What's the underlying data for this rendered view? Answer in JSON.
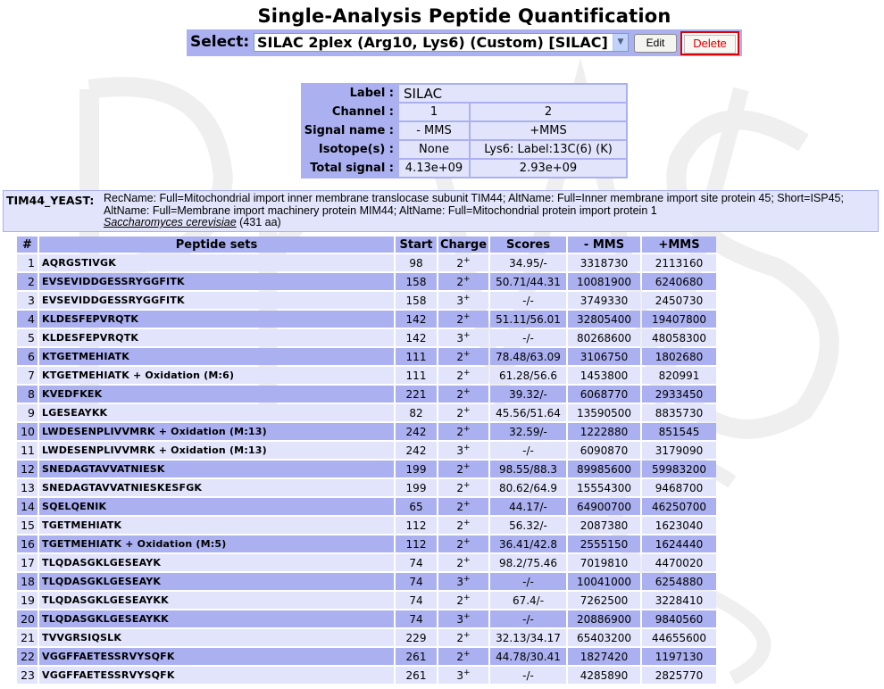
{
  "page": {
    "title": "Single-Analysis Peptide Quantification"
  },
  "select": {
    "label": "Select:",
    "value": "SILAC 2plex (Arg10, Lys6) (Custom) [SILAC]",
    "edit_label": "Edit",
    "delete_label": "Delete"
  },
  "label_table": {
    "label_header": "Label :",
    "label_value": "SILAC",
    "channel_header": "Channel :",
    "signal_header": "Signal name :",
    "isotope_header": "Isotope(s) :",
    "total_header": "Total signal :",
    "channels": [
      {
        "number": "1",
        "signal_name": "- MMS",
        "isotopes": "None",
        "total_signal": "4.13e+09"
      },
      {
        "number": "2",
        "signal_name": "+MMS",
        "isotopes": "Lys6: Label:13C(6) (K)",
        "total_signal": "2.93e+09"
      }
    ]
  },
  "protein": {
    "accession": "TIM44_YEAST:",
    "description": "RecName: Full=Mitochondrial import inner membrane translocase subunit TIM44; AltName: Full=Inner membrane import site protein 45; Short=ISP45; AltName: Full=Membrane import machinery protein MIM44; AltName: Full=Mitochondrial protein import protein 1",
    "species": "Saccharomyces cerevisiae",
    "length": "(431 aa)"
  },
  "peptide_table": {
    "headers": [
      "#",
      "Peptide sets",
      "Start",
      "Charge",
      "Scores",
      "- MMS",
      "+MMS"
    ],
    "rows": [
      {
        "n": "1",
        "seq": "AQRGSTIVGK",
        "start": "98",
        "charge": "2",
        "score": "34.95/-",
        "mms": "3318730",
        "pmms": "2113160"
      },
      {
        "n": "2",
        "seq": "EVSEVIDDGESSRYGGFITK",
        "start": "158",
        "charge": "2",
        "score": "50.71/44.31",
        "mms": "10081900",
        "pmms": "6240680"
      },
      {
        "n": "3",
        "seq": "EVSEVIDDGESSRYGGFITK",
        "start": "158",
        "charge": "3",
        "score": "-/-",
        "mms": "3749330",
        "pmms": "2450730"
      },
      {
        "n": "4",
        "seq": "KLDESFEPVRQTK",
        "start": "142",
        "charge": "2",
        "score": "51.11/56.01",
        "mms": "32805400",
        "pmms": "19407800"
      },
      {
        "n": "5",
        "seq": "KLDESFEPVRQTK",
        "start": "142",
        "charge": "3",
        "score": "-/-",
        "mms": "80268600",
        "pmms": "48058300"
      },
      {
        "n": "6",
        "seq": "KTGETMEHIATK",
        "start": "111",
        "charge": "2",
        "score": "78.48/63.09",
        "mms": "3106750",
        "pmms": "1802680"
      },
      {
        "n": "7",
        "seq": "KTGETMEHIATK + Oxidation (M:6)",
        "start": "111",
        "charge": "2",
        "score": "61.28/56.6",
        "mms": "1453800",
        "pmms": "820991"
      },
      {
        "n": "8",
        "seq": "KVEDFKEK",
        "start": "221",
        "charge": "2",
        "score": "39.32/-",
        "mms": "6068770",
        "pmms": "2933450"
      },
      {
        "n": "9",
        "seq": "LGESEAYKK",
        "start": "82",
        "charge": "2",
        "score": "45.56/51.64",
        "mms": "13590500",
        "pmms": "8835730"
      },
      {
        "n": "10",
        "seq": "LWDESENPLIVVMRK + Oxidation (M:13)",
        "start": "242",
        "charge": "2",
        "score": "32.59/-",
        "mms": "1222880",
        "pmms": "851545"
      },
      {
        "n": "11",
        "seq": "LWDESENPLIVVMRK + Oxidation (M:13)",
        "start": "242",
        "charge": "3",
        "score": "-/-",
        "mms": "6090870",
        "pmms": "3179090"
      },
      {
        "n": "12",
        "seq": "SNEDAGTAVVATNIESK",
        "start": "199",
        "charge": "2",
        "score": "98.55/88.3",
        "mms": "89985600",
        "pmms": "59983200"
      },
      {
        "n": "13",
        "seq": "SNEDAGTAVVATNIESKESFGK",
        "start": "199",
        "charge": "2",
        "score": "80.62/64.9",
        "mms": "15554300",
        "pmms": "9468700"
      },
      {
        "n": "14",
        "seq": "SQELQENIK",
        "start": "65",
        "charge": "2",
        "score": "44.17/-",
        "mms": "64900700",
        "pmms": "46250700"
      },
      {
        "n": "15",
        "seq": "TGETMEHIATK",
        "start": "112",
        "charge": "2",
        "score": "56.32/-",
        "mms": "2087380",
        "pmms": "1623040"
      },
      {
        "n": "16",
        "seq": "TGETMEHIATK + Oxidation (M:5)",
        "start": "112",
        "charge": "2",
        "score": "36.41/42.8",
        "mms": "2555150",
        "pmms": "1624440"
      },
      {
        "n": "17",
        "seq": "TLQDASGKLGESEAYK",
        "start": "74",
        "charge": "2",
        "score": "98.2/75.46",
        "mms": "7019810",
        "pmms": "4470020"
      },
      {
        "n": "18",
        "seq": "TLQDASGKLGESEAYK",
        "start": "74",
        "charge": "3",
        "score": "-/-",
        "mms": "10041000",
        "pmms": "6254880"
      },
      {
        "n": "19",
        "seq": "TLQDASGKLGESEAYKK",
        "start": "74",
        "charge": "2",
        "score": "67.4/-",
        "mms": "7262500",
        "pmms": "3228410"
      },
      {
        "n": "20",
        "seq": "TLQDASGKLGESEAYKK",
        "start": "74",
        "charge": "3",
        "score": "-/-",
        "mms": "20886900",
        "pmms": "9840560"
      },
      {
        "n": "21",
        "seq": "TVVGRSIQSLK",
        "start": "229",
        "charge": "2",
        "score": "32.13/34.17",
        "mms": "65403200",
        "pmms": "44655600"
      },
      {
        "n": "22",
        "seq": "VGGFFAETESSRVYSQFK",
        "start": "261",
        "charge": "2",
        "score": "44.78/30.41",
        "mms": "1827420",
        "pmms": "1197130"
      },
      {
        "n": "23",
        "seq": "VGGFFAETESSRVYSQFK",
        "start": "261",
        "charge": "3",
        "score": "-/-",
        "mms": "4285890",
        "pmms": "2825770"
      }
    ]
  },
  "colors": {
    "header_bg": "#aab0f0",
    "row_light": "#e1e4fa",
    "delete_red": "#dd0000"
  }
}
